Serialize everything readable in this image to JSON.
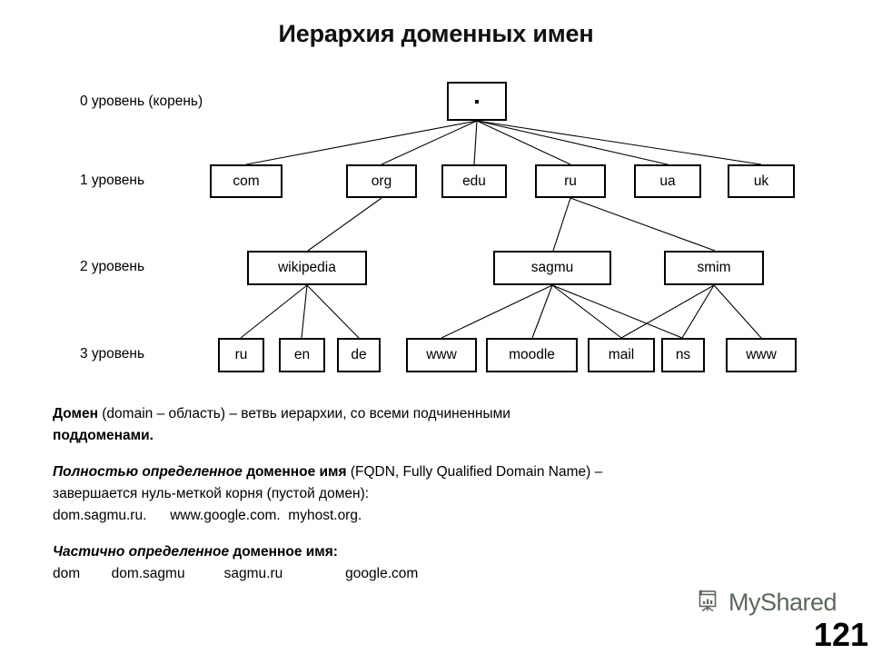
{
  "slide": {
    "title": "Иерархия доменных имен",
    "page_number": "121"
  },
  "diagram": {
    "level_labels": [
      "0 уровень (корень)",
      "1 уровень",
      "2 уровень",
      "3 уровень"
    ],
    "nodes": {
      "root": ".",
      "level1": [
        "com",
        "org",
        "edu",
        "ru",
        "ua",
        "uk"
      ],
      "level2": [
        "wikipedia",
        "sagmu",
        "smim"
      ],
      "level3": [
        "ru",
        "en",
        "de",
        "www",
        "moodle",
        "mail",
        "ns",
        "www"
      ]
    },
    "edges": [
      {
        "from": "root",
        "to": "com"
      },
      {
        "from": "root",
        "to": "org"
      },
      {
        "from": "root",
        "to": "edu"
      },
      {
        "from": "root",
        "to": "ru"
      },
      {
        "from": "root",
        "to": "ua"
      },
      {
        "from": "root",
        "to": "uk"
      },
      {
        "from": "org",
        "to": "wikipedia"
      },
      {
        "from": "ru",
        "to": "sagmu"
      },
      {
        "from": "ru",
        "to": "smim"
      },
      {
        "from": "wikipedia",
        "to": "ru3"
      },
      {
        "from": "wikipedia",
        "to": "en3"
      },
      {
        "from": "wikipedia",
        "to": "de3"
      },
      {
        "from": "sagmu",
        "to": "www1"
      },
      {
        "from": "sagmu",
        "to": "moodle"
      },
      {
        "from": "sagmu",
        "to": "mail"
      },
      {
        "from": "sagmu",
        "to": "ns"
      },
      {
        "from": "smim",
        "to": "mail"
      },
      {
        "from": "smim",
        "to": "ns"
      },
      {
        "from": "smim",
        "to": "www2"
      }
    ]
  },
  "text": {
    "domain_def": {
      "term": "Домен",
      "paren": " (domain – область) ",
      "body": "– ветвь иерархии, со всеми подчиненными ",
      "tail": "поддоменами."
    },
    "fqdn": {
      "emph": "Полностью определенное",
      "bold": " доменное имя",
      "rest": " (FQDN, Fully Qualified Domain Name) –",
      "line2": "завершается нуль-меткой корня (пустой домен):",
      "examples": "dom.sagmu.ru.      www.google.com.  myhost.org."
    },
    "partial": {
      "emph": "Частично определенное",
      "bold": " доменное имя",
      "colon": ":",
      "examples": "dom        dom.sagmu          sagmu.ru                google.com"
    }
  },
  "footer": {
    "brand_name": "MyShared",
    "brand_icon": "presentation-chart-icon"
  },
  "colors": {
    "ink": "#000000",
    "brand": "#5a6a5a",
    "background": "#ffffff"
  }
}
